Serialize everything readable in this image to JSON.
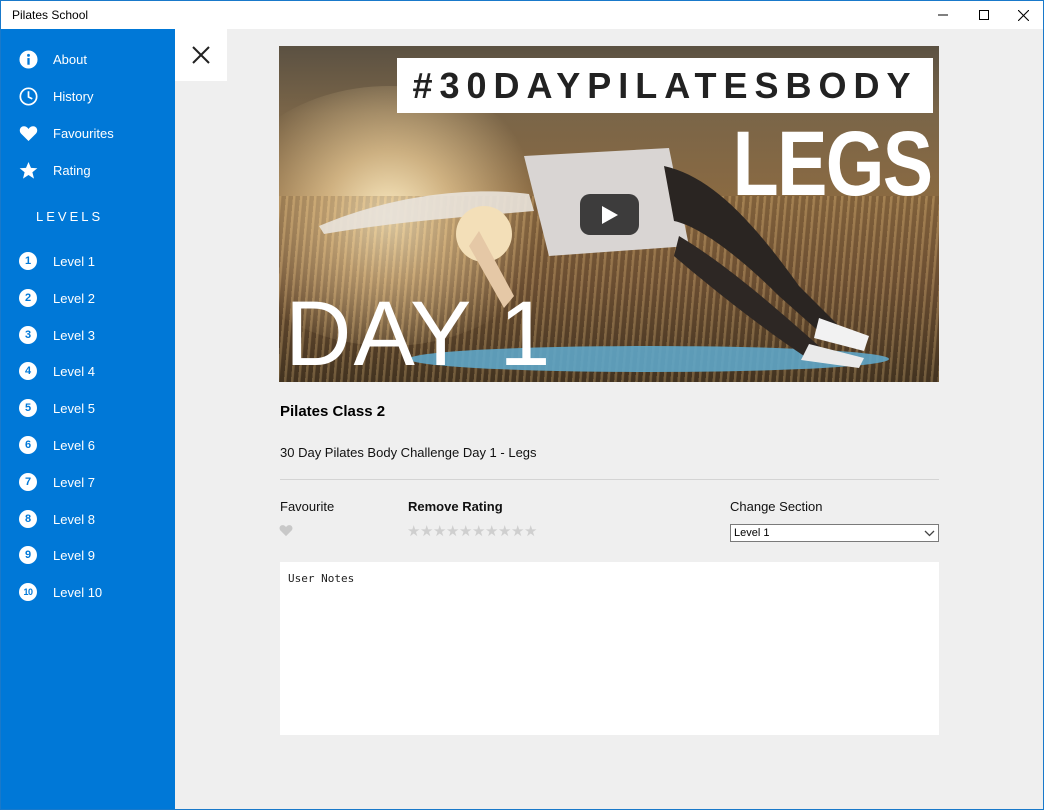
{
  "window": {
    "title": "Pilates School"
  },
  "sidebar": {
    "items": [
      {
        "label": "About",
        "icon": "info-icon"
      },
      {
        "label": "History",
        "icon": "clock-icon"
      },
      {
        "label": "Favourites",
        "icon": "heart-icon"
      },
      {
        "label": "Rating",
        "icon": "star-icon"
      }
    ],
    "levels_heading": "LEVELS",
    "levels": [
      {
        "number": "1",
        "label": "Level 1"
      },
      {
        "number": "2",
        "label": "Level 2"
      },
      {
        "number": "3",
        "label": "Level 3"
      },
      {
        "number": "4",
        "label": "Level 4"
      },
      {
        "number": "5",
        "label": "Level 5"
      },
      {
        "number": "6",
        "label": "Level 6"
      },
      {
        "number": "7",
        "label": "Level 7"
      },
      {
        "number": "8",
        "label": "Level 8"
      },
      {
        "number": "9",
        "label": "Level 9"
      },
      {
        "number": "10",
        "label": "Level 10"
      }
    ]
  },
  "video": {
    "banner_text": "#30DAYPILATESBODY",
    "big_text": "LEGS",
    "day_text": "DAY 1"
  },
  "detail": {
    "title": "Pilates Class 2",
    "description": "30 Day Pilates Body Challenge Day 1 - Legs",
    "favourite_label": "Favourite",
    "rating_label": "Remove Rating",
    "rating_value": 0,
    "rating_max": 10,
    "section_label": "Change Section",
    "section_value": "Level 1",
    "notes_placeholder": "User Notes"
  },
  "colors": {
    "accent": "#0078d7",
    "content_bg": "#efefef",
    "star_empty": "#cfcfcf"
  }
}
